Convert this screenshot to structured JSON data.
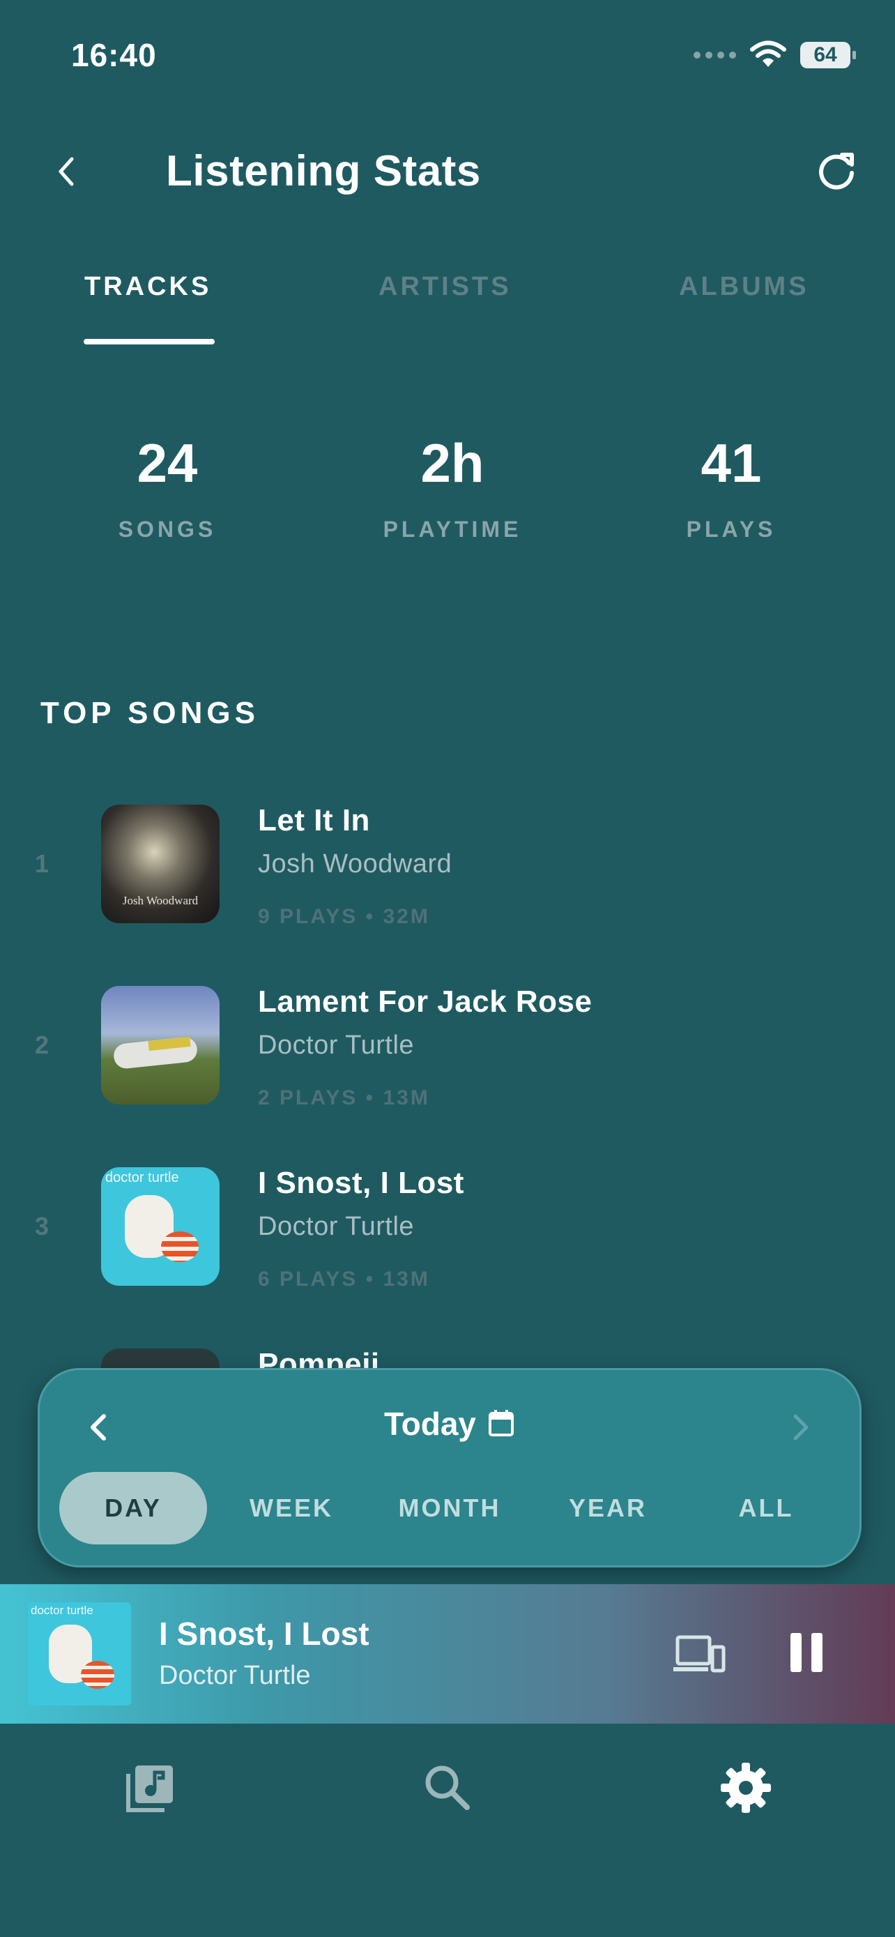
{
  "status_bar": {
    "time": "16:40",
    "battery": "64"
  },
  "header": {
    "title": "Listening Stats"
  },
  "tabs": [
    {
      "label": "TRACKS",
      "active": true
    },
    {
      "label": "ARTISTS",
      "active": false
    },
    {
      "label": "ALBUMS",
      "active": false
    }
  ],
  "stats": [
    {
      "value": "24",
      "label": "SONGS"
    },
    {
      "value": "2h",
      "label": "PLAYTIME"
    },
    {
      "value": "41",
      "label": "PLAYS"
    }
  ],
  "section_title": "TOP SONGS",
  "songs": [
    {
      "rank": "1",
      "title": "Let It In",
      "artist": "Josh Woodward",
      "meta": "9 PLAYS • 32M",
      "art_text": "Josh Woodward"
    },
    {
      "rank": "2",
      "title": "Lament For Jack Rose",
      "artist": "Doctor Turtle",
      "meta": "2 PLAYS • 13M"
    },
    {
      "rank": "3",
      "title": "I Snost, I Lost",
      "artist": "Doctor Turtle",
      "meta": "6 PLAYS • 13M",
      "art_text": "doctor turtle"
    },
    {
      "rank": "",
      "title": "Pompeii",
      "artist": "",
      "meta": ""
    }
  ],
  "range_picker": {
    "label": "Today",
    "periods": [
      {
        "label": "DAY",
        "active": true
      },
      {
        "label": "WEEK",
        "active": false
      },
      {
        "label": "MONTH",
        "active": false
      },
      {
        "label": "YEAR",
        "active": false
      },
      {
        "label": "ALL",
        "active": false
      }
    ]
  },
  "now_playing": {
    "title": "I Snost, I Lost",
    "artist": "Doctor Turtle",
    "art_text": "doctor turtle"
  },
  "bottom_nav": [
    {
      "icon": "library-music-icon",
      "active": false
    },
    {
      "icon": "search-icon",
      "active": false
    },
    {
      "icon": "gear-icon",
      "active": true
    }
  ],
  "colors": {
    "background": "#1f5a61",
    "card": "#2c848c",
    "accent": "#ffffff",
    "muted": "#5f8186"
  }
}
